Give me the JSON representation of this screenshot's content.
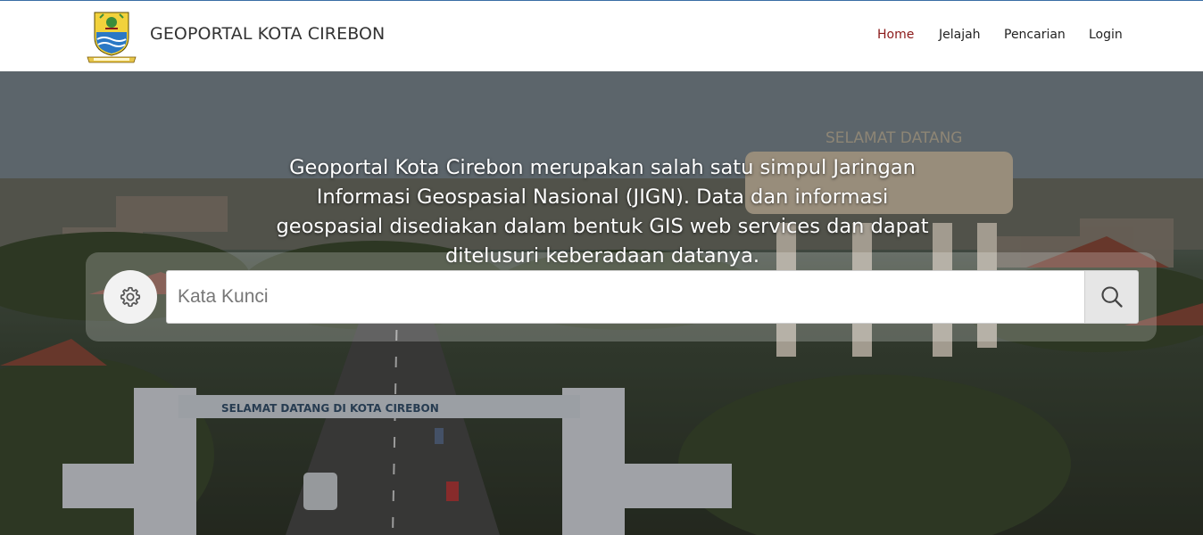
{
  "header": {
    "brand": "GEOPORTAL KOTA CIREBON",
    "logo_icon": "city-crest-icon",
    "nav": [
      {
        "label": "Home",
        "active": true
      },
      {
        "label": "Jelajah",
        "active": false
      },
      {
        "label": "Pencarian",
        "active": false
      },
      {
        "label": "Login",
        "active": false
      }
    ]
  },
  "hero": {
    "description": "Geoportal Kota Cirebon merupakan salah satu simpul Jaringan Informasi Geospasial Nasional (JIGN). Data dan informasi geospasial disediakan dalam bentuk GIS web services dan dapat ditelusuri keberadaan datanya.",
    "background_signs": [
      "SELAMAT DATANG",
      "SELAMAT DATANG DI KOTA CIREBON"
    ]
  },
  "search": {
    "placeholder": "Kata Kunci",
    "settings_icon": "gear-icon",
    "submit_icon": "search-icon"
  },
  "colors": {
    "nav_active": "#8b1a1a",
    "header_bg": "#ffffff",
    "top_border": "#3a6ea5"
  }
}
